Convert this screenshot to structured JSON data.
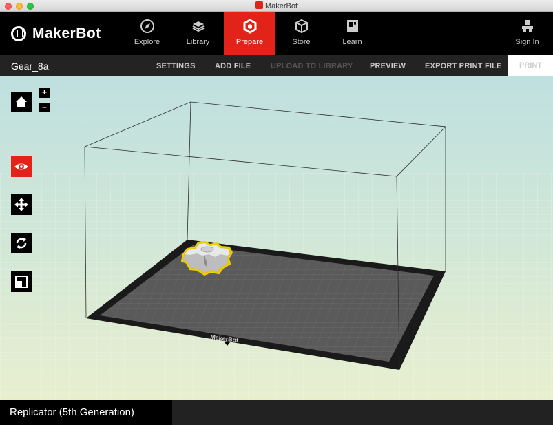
{
  "window": {
    "title": "MakerBot"
  },
  "brand": {
    "logo_text": "MakerBot",
    "accent": "#e2231a"
  },
  "nav": {
    "items": [
      {
        "label": "Explore",
        "icon": "compass-icon",
        "active": false
      },
      {
        "label": "Library",
        "icon": "library-icon",
        "active": false
      },
      {
        "label": "Prepare",
        "icon": "prepare-icon",
        "active": true
      },
      {
        "label": "Store",
        "icon": "store-icon",
        "active": false
      },
      {
        "label": "Learn",
        "icon": "learn-icon",
        "active": false
      }
    ],
    "sign_in": {
      "label": "Sign In",
      "icon": "user-icon"
    }
  },
  "toolbar": {
    "document_name": "Gear_8a",
    "settings": "SETTINGS",
    "add_file": "ADD FILE",
    "upload_to_library": "UPLOAD TO LIBRARY",
    "preview": "PREVIEW",
    "export_print_file": "EXPORT PRINT FILE",
    "print": "PRINT"
  },
  "sidebar": {
    "home_icon": "home-icon",
    "zoom_in": "+",
    "zoom_out": "–",
    "tools": [
      {
        "icon": "eye-icon",
        "active": true
      },
      {
        "icon": "move-icon",
        "active": false
      },
      {
        "icon": "rotate-icon",
        "active": false
      },
      {
        "icon": "scale-icon",
        "active": false
      }
    ]
  },
  "build_plate": {
    "brand_text": "MakerBot"
  },
  "status": {
    "printer_name": "Replicator (5th Generation)"
  }
}
